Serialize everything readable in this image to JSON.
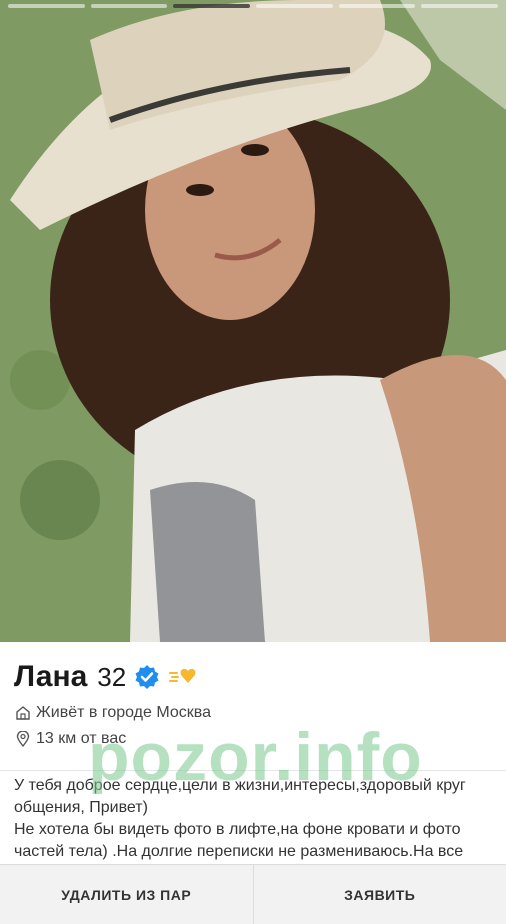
{
  "photo": {
    "alt": "Profile photo"
  },
  "progress": {
    "segments": 6,
    "active_index": 2
  },
  "profile": {
    "name": "Лана",
    "age": "32",
    "location": "Живёт в городе Москва",
    "distance": "13 км от вас"
  },
  "watermark": "pozor.info",
  "bio": {
    "line1": "У тебя доброе сердце,цели в жизни,интересы,здоровый круг общения, Привет)",
    "line2": "Не хотела бы видеть фото в лифте,на фоне кровати и фото частей тела) .На долгие переписки не размениваюсь.На все"
  },
  "actions": {
    "remove": "УДАЛИТЬ ИЗ ПАР",
    "report": "ЗАЯВИТЬ"
  },
  "colors": {
    "verified": "#1f8ef1",
    "superlike_star": "#f5b82e"
  }
}
